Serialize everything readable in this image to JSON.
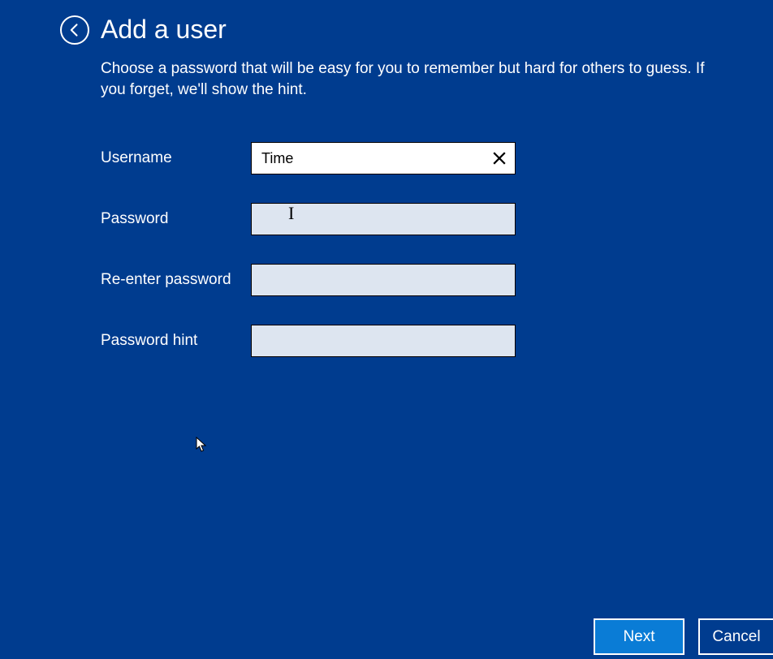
{
  "header": {
    "title": "Add a user"
  },
  "description": "Choose a password that will be easy for you to remember but hard for others to guess. If you forget, we'll show the hint.",
  "form": {
    "username_label": "Username",
    "username_value": "Time",
    "password_label": "Password",
    "password_value": "",
    "reenter_label": "Re-enter password",
    "reenter_value": "",
    "hint_label": "Password hint",
    "hint_value": ""
  },
  "footer": {
    "next_label": "Next",
    "cancel_label": "Cancel"
  }
}
